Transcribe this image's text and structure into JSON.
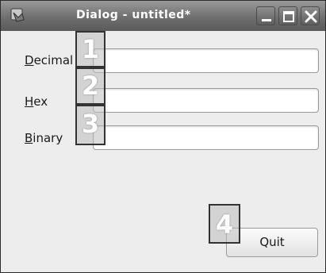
{
  "window": {
    "title": "Dialog - untitled*"
  },
  "form": {
    "decimal_label_accel": "D",
    "decimal_label_rest": "ecimal",
    "decimal_value": "",
    "hex_label_accel": "H",
    "hex_label_rest": "ex",
    "hex_value": "",
    "binary_label_accel": "B",
    "binary_label_rest": "inary",
    "binary_value": ""
  },
  "buttons": {
    "quit_label": "Quit"
  },
  "overlays": {
    "n1": "1",
    "n2": "2",
    "n3": "3",
    "n4": "4"
  },
  "icons": {
    "app": "app-icon",
    "minimize": "minimize-icon",
    "maximize": "maximize-icon",
    "close": "close-icon"
  },
  "colors": {
    "titlebar_top": "#9a9a9a",
    "titlebar_bottom": "#5a5a5a",
    "window_bg": "#ededed",
    "overlay_border": "#333333"
  }
}
